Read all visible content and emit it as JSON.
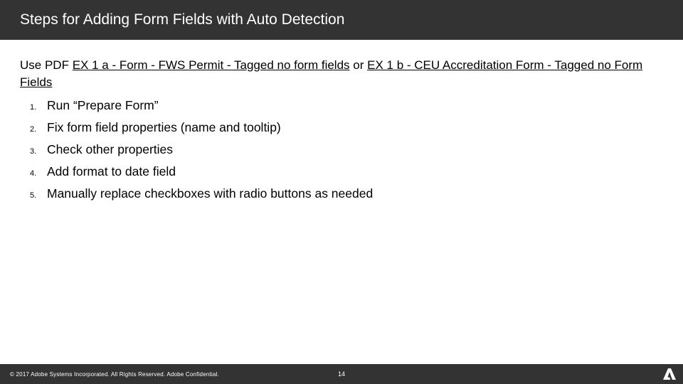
{
  "header": {
    "title": "Steps for Adding Form Fields with Auto Detection"
  },
  "intro": {
    "prefix": " Use PDF ",
    "link1": "EX 1 a - Form - FWS Permit - Tagged no form fields",
    "mid": " or ",
    "link2": "EX 1 b - CEU Accreditation Form - Tagged no Form Fields"
  },
  "steps": [
    {
      "num": "1.",
      "text": "Run “Prepare Form”"
    },
    {
      "num": "2.",
      "text": "Fix form field properties (name and tooltip)"
    },
    {
      "num": "3.",
      "text": "Check other properties"
    },
    {
      "num": "4.",
      "text": "Add format to date field"
    },
    {
      "num": "5.",
      "text": "Manually replace checkboxes with radio buttons as needed"
    }
  ],
  "footer": {
    "copyright": "© 2017 Adobe Systems Incorporated.  All Rights Reserved.  Adobe Confidential.",
    "page": "14",
    "logo_name": "adobe-logo"
  }
}
